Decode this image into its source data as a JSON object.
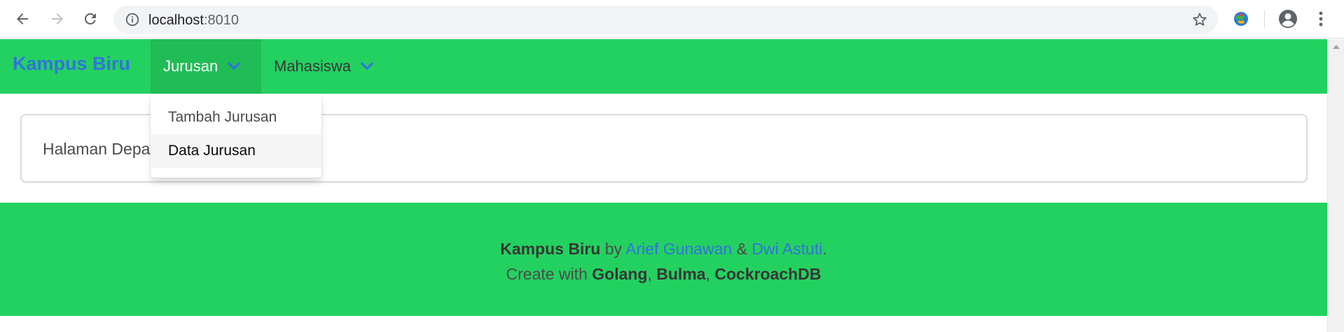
{
  "browser": {
    "url_host": "localhost",
    "url_port": ":8010",
    "icons": [
      "back-arrow-icon",
      "forward-arrow-icon",
      "reload-icon",
      "info-icon",
      "bookmark-star-icon",
      "extension-icon",
      "profile-icon",
      "menu-dots-icon"
    ]
  },
  "navbar": {
    "brand": "Kampus Biru",
    "items": [
      {
        "label": "Jurusan",
        "active": true
      },
      {
        "label": "Mahasiswa",
        "active": false
      }
    ],
    "dropdown": [
      {
        "label": "Tambah Jurusan"
      },
      {
        "label": "Data Jurusan"
      }
    ]
  },
  "main": {
    "card_text": "Halaman Depa"
  },
  "footer": {
    "brand": "Kampus Biru",
    "by": " by ",
    "author1": "Arief Gunawan",
    "amp": " & ",
    "author2": "Dwi Astuti",
    "period": ".",
    "create_with": "Create with ",
    "tech1": "Golang",
    "comma1": ", ",
    "tech2": "Bulma",
    "comma2": ", ",
    "tech3": "CockroachDB"
  },
  "colors": {
    "primary_green": "#23d160",
    "active_green": "#20bc56",
    "link_blue": "#3273dc"
  }
}
